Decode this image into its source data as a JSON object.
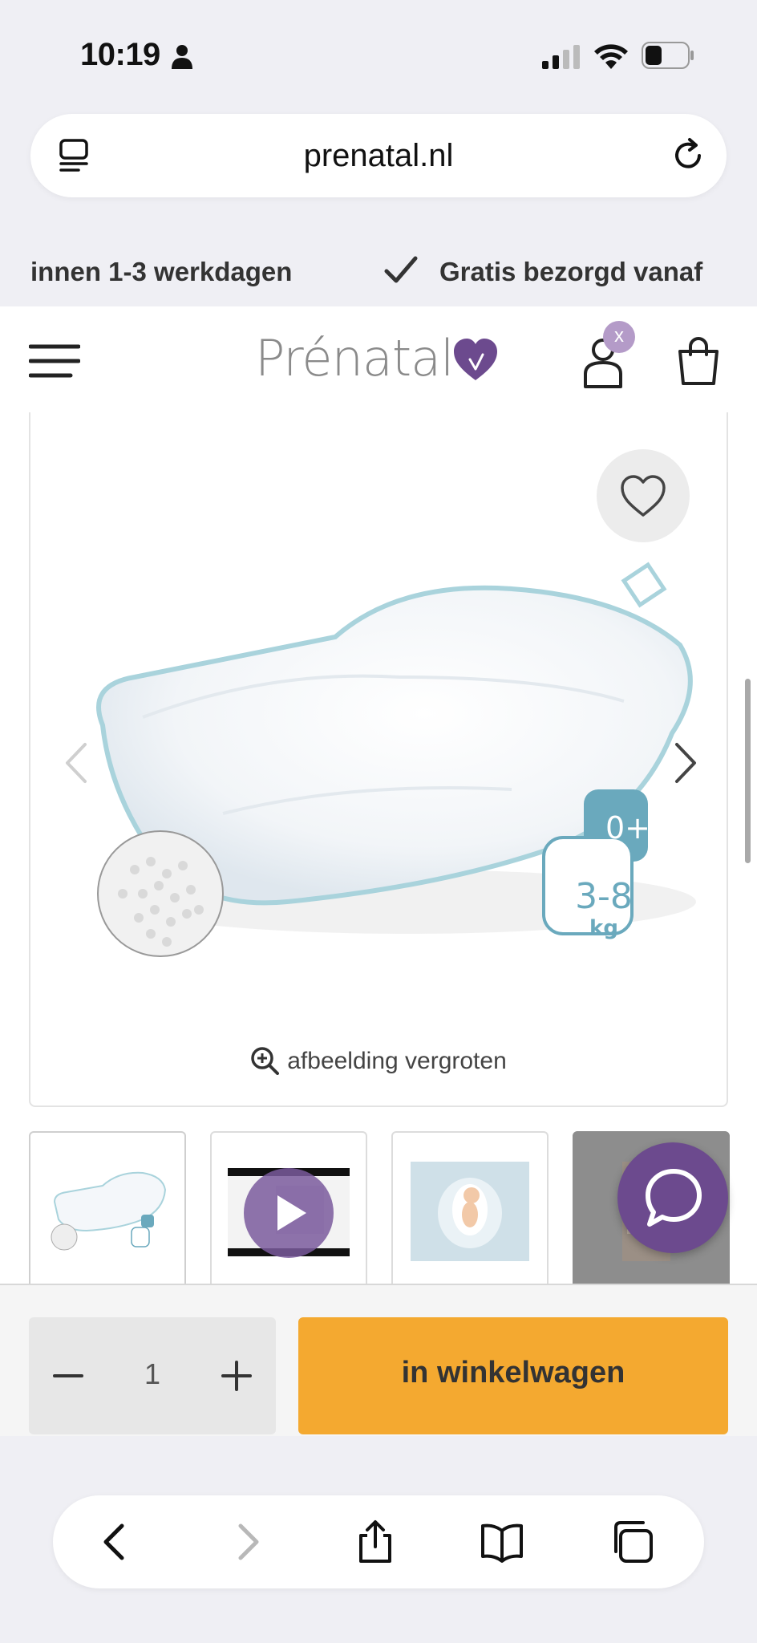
{
  "status_bar": {
    "time": "10:19"
  },
  "browser": {
    "url": "prenatal.nl"
  },
  "usp_marquee": {
    "text_1": "innen 1-3 werkdagen",
    "text_2": "Gratis bezorgd vanaf"
  },
  "header": {
    "logo_text": "Prénatal",
    "account_badge": "x"
  },
  "product_gallery": {
    "zoom_label": "afbeelding vergroten",
    "age_badge": "0+",
    "weight_range": "3-8",
    "weight_unit": "kg"
  },
  "purchase": {
    "quantity": "1",
    "add_to_cart_label": "in winkelwagen"
  },
  "colors": {
    "brand_purple": "#6c4a8e",
    "cart_button": "#f4a930",
    "badge_teal": "#6aa9bd"
  }
}
